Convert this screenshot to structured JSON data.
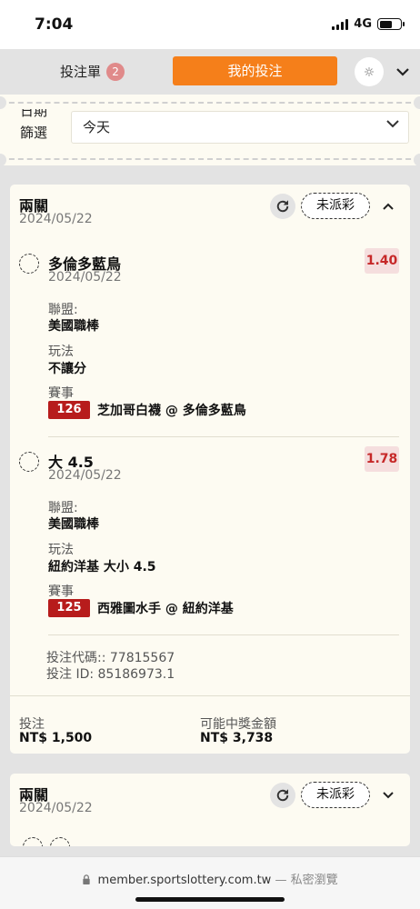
{
  "status_bar": {
    "time": "7:04",
    "network": "4G"
  },
  "tabs": {
    "betslip_label": "投注單",
    "betslip_count": "2",
    "mybets_label": "我的投注"
  },
  "filter": {
    "label_top": "日期",
    "label_bottom": "篩選",
    "selected": "今天"
  },
  "bets": [
    {
      "type": "兩關",
      "date": "2024/05/22",
      "status": "未派彩",
      "legs": [
        {
          "name": "多倫多藍鳥",
          "date": "2024/05/22",
          "odds": "1.40",
          "league_label": "聯盟:",
          "league": "美國職棒",
          "market_label": "玩法",
          "market": "不讓分",
          "event_label": "賽事",
          "event_no": "126",
          "event_name": "芝加哥白襪 @ 多倫多藍鳥"
        },
        {
          "name": "大 4.5",
          "date": "2024/05/22",
          "odds": "1.78",
          "league_label": "聯盟:",
          "league": "美國職棒",
          "market_label": "玩法",
          "market": "紐約洋基 大小 4.5",
          "event_label": "賽事",
          "event_no": "125",
          "event_name": "西雅圖水手 @ 紐約洋基"
        }
      ],
      "code": "投注代碼:: 77815567",
      "bet_id": "投注 ID: 85186973.1",
      "stake_label": "投注",
      "stake": "NT$ 1,500",
      "payout_label": "可能中獎金額",
      "payout": "NT$ 3,738"
    },
    {
      "type": "兩關",
      "date": "2024/05/22",
      "status": "未派彩"
    }
  ],
  "browser": {
    "url": "member.sportslottery.com.tw",
    "mode": "— 私密瀏覽"
  },
  "colors": {
    "accent": "#f57f1a",
    "event_badge": "#b71c1c",
    "odds_text": "#c62828",
    "card_bg": "#fdfbf2"
  },
  "icons": [
    "signal-icon",
    "battery-icon",
    "gear-icon",
    "chevron-down-icon",
    "refresh-icon",
    "chevron-up-icon",
    "lock-icon"
  ]
}
